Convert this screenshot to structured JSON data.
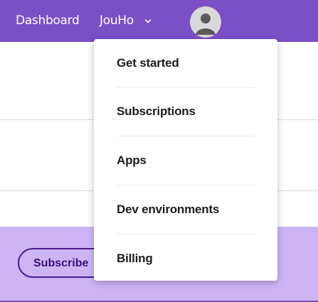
{
  "topbar": {
    "dashboard_label": "Dashboard",
    "user_label": "JouHo",
    "bg_color": "#7b4fc6"
  },
  "menu": {
    "items": [
      {
        "label": "Get started"
      },
      {
        "label": "Subscriptions"
      },
      {
        "label": "Apps"
      },
      {
        "label": "Dev environments"
      },
      {
        "label": "Billing"
      }
    ]
  },
  "page": {
    "subscribe_label": "Subscribe",
    "band_color": "#cdb5f5"
  }
}
